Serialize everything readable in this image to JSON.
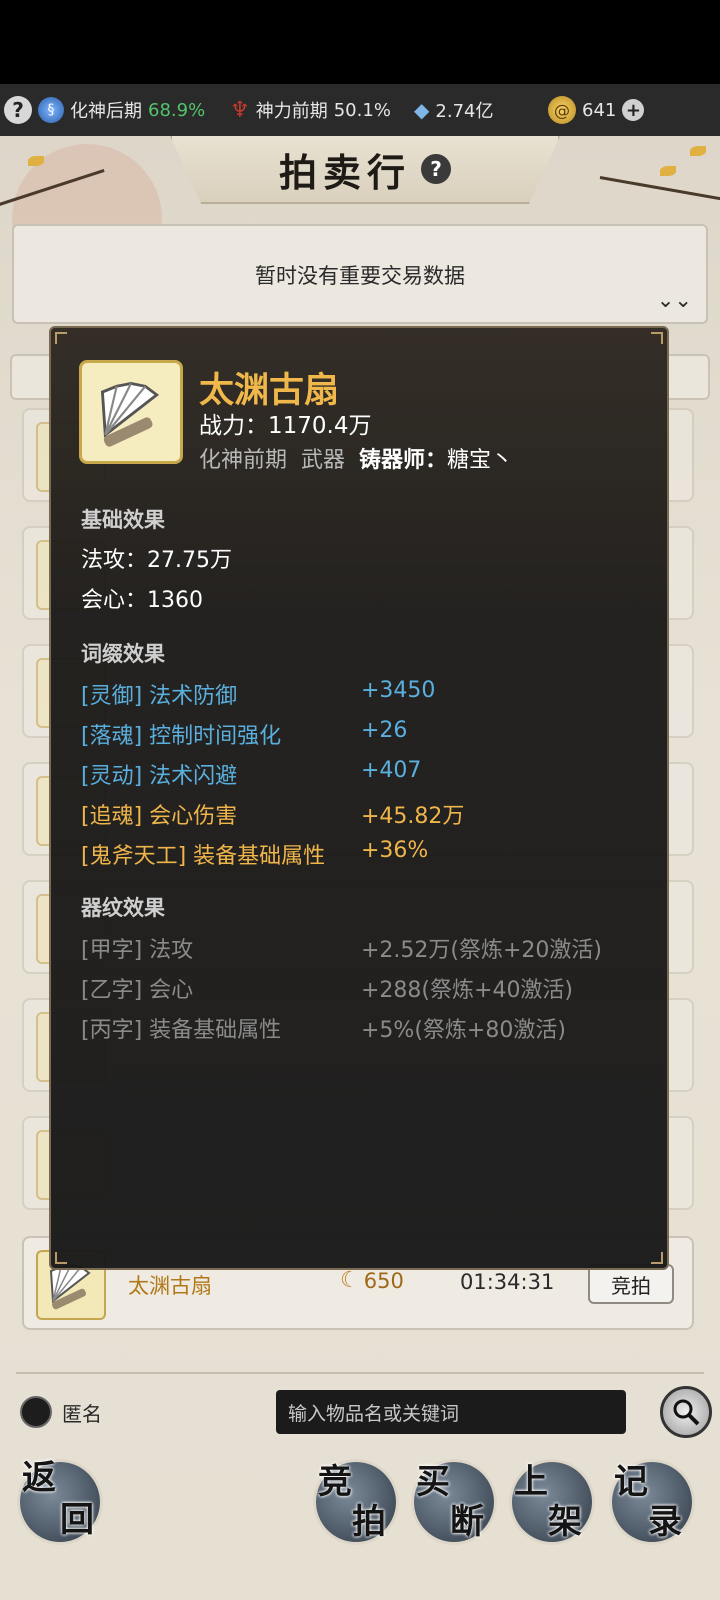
{
  "resources": {
    "realm_label": "化神后期",
    "realm_pct": "68.9%",
    "divine_label": "神力前期",
    "divine_pct": "50.1%",
    "stones": "2.74亿",
    "gold": "641"
  },
  "page_title": "拍卖行",
  "notice": "暂时没有重要交易数据",
  "listings": [
    {
      "name": "太渊古扇",
      "price": "650",
      "time": "01:34:31",
      "bid_label": "竞拍"
    }
  ],
  "tooltip": {
    "item_name": "太渊古扇",
    "power_label": "战力：",
    "power_value": "1170.4万",
    "realm": "化神前期",
    "slot": "武器",
    "smith_label": "铸器师：",
    "smith_name": "糖宝丶",
    "base_title": "基础效果",
    "base": [
      {
        "label": "法攻：",
        "value": "27.75万"
      },
      {
        "label": "会心：",
        "value": "1360"
      }
    ],
    "affix_title": "词缀效果",
    "affixes": [
      {
        "tag": "[灵御]",
        "name": "法术防御",
        "value": "+3450"
      },
      {
        "tag": "[落魂]",
        "name": "控制时间强化",
        "value": "+26"
      },
      {
        "tag": "[灵动]",
        "name": "法术闪避",
        "value": "+407"
      },
      {
        "tag": "[追魂]",
        "name": "会心伤害",
        "value": "+45.82万"
      },
      {
        "tag": "[鬼斧天工]",
        "name": "装备基础属性",
        "value": "+36%"
      }
    ],
    "rune_title": "器纹效果",
    "runes": [
      {
        "tag": "[甲字]",
        "name": "法攻",
        "value": "+2.52万(祭炼+20激活)"
      },
      {
        "tag": "[乙字]",
        "name": "会心",
        "value": "+288(祭炼+40激活)"
      },
      {
        "tag": "[丙字]",
        "name": "装备基础属性",
        "value": "+5%(祭炼+80激活)"
      }
    ]
  },
  "anonymous_label": "匿名",
  "search_placeholder": "输入物品名或关键词",
  "nav": {
    "back": [
      "返",
      "回"
    ],
    "bid": [
      "竞",
      "拍"
    ],
    "buyout": [
      "买",
      "断"
    ],
    "list": [
      "上",
      "架"
    ],
    "record": [
      "记",
      "录"
    ]
  },
  "colors": {
    "accent_gold": "#f0b84a",
    "affix_blue": "#59b0de",
    "realm_green": "#52c46a"
  }
}
